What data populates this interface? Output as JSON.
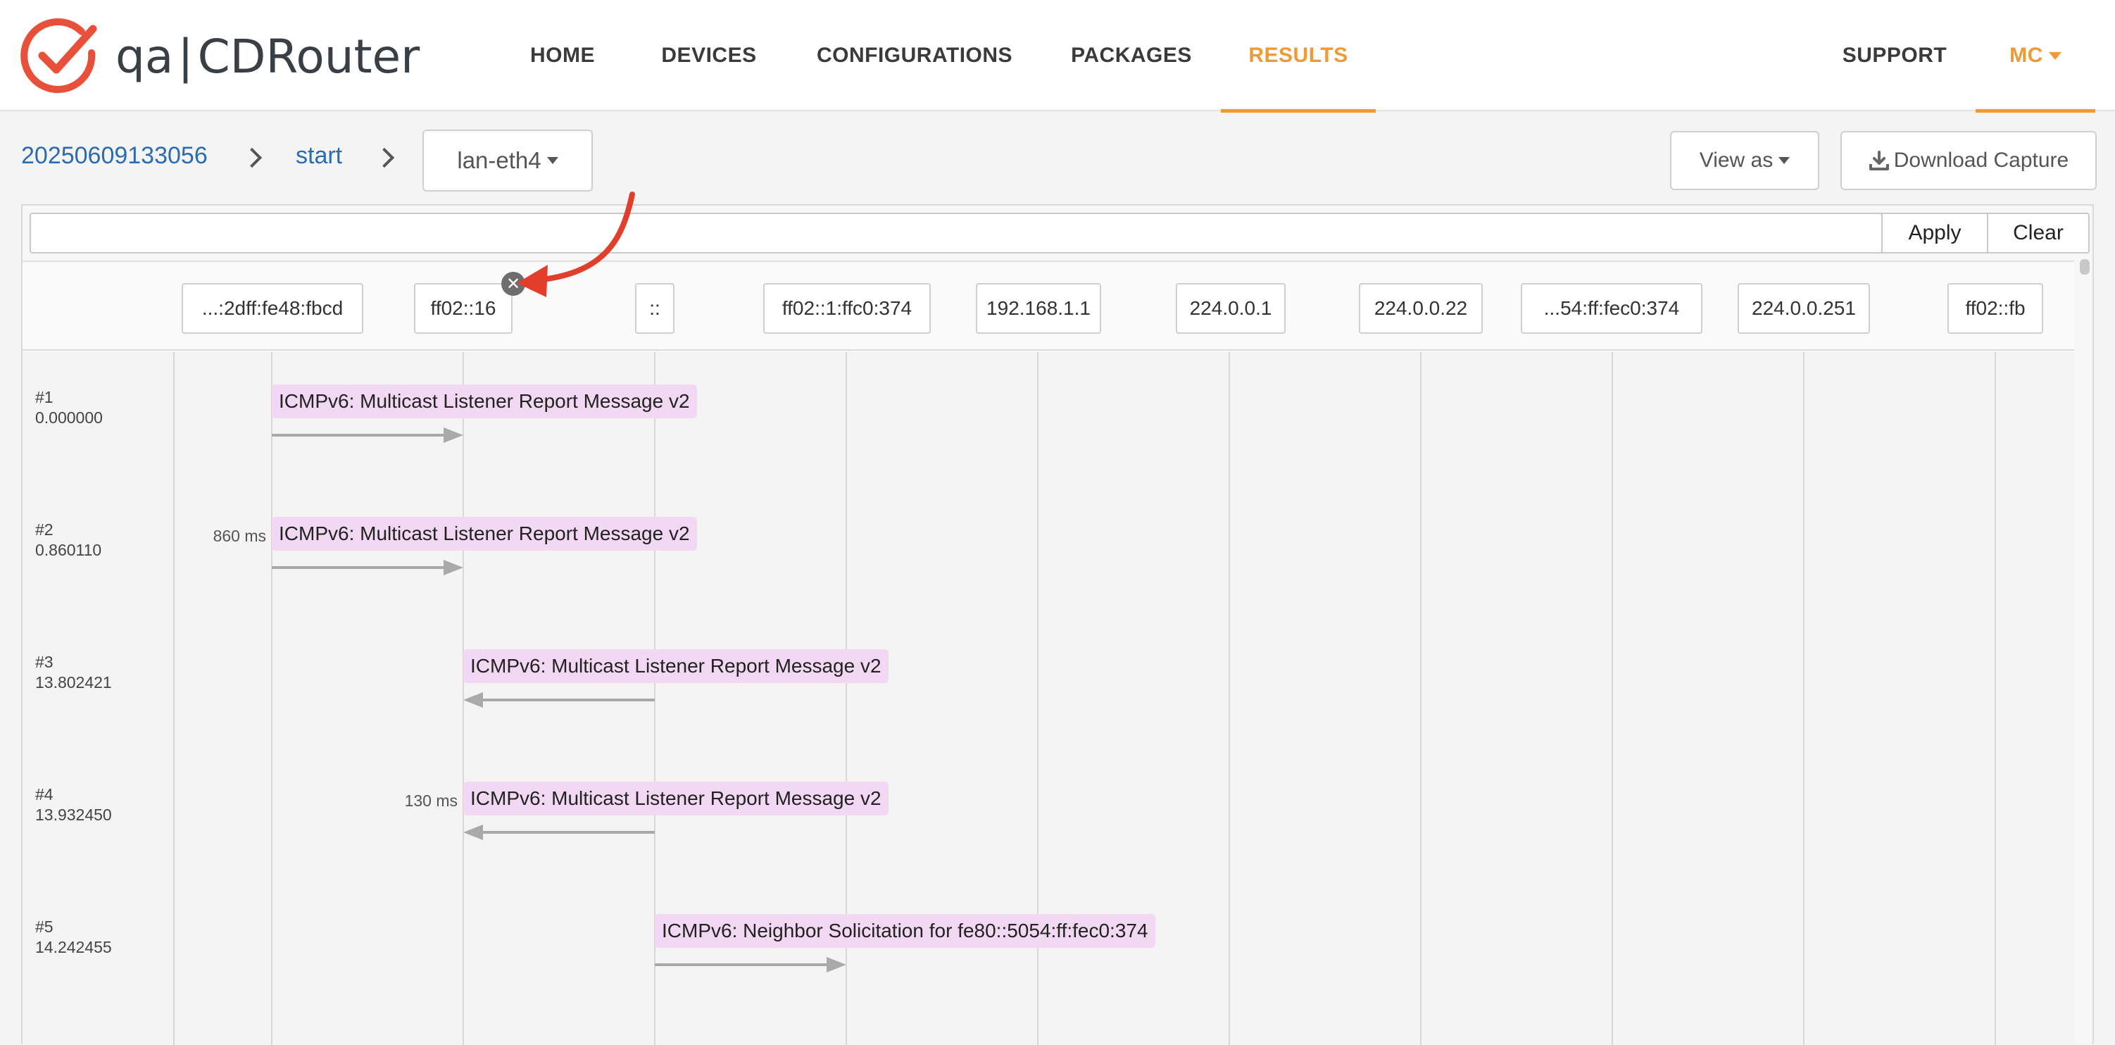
{
  "app": {
    "logo_prefix": "qa",
    "logo_name": "CDRouter",
    "brand_color": "#e8503a",
    "accent_color": "#ef9a34"
  },
  "nav": {
    "items": [
      "HOME",
      "DEVICES",
      "CONFIGURATIONS",
      "PACKAGES",
      "RESULTS"
    ],
    "active": "RESULTS",
    "support": "SUPPORT",
    "user": "MC"
  },
  "breadcrumb": {
    "result_id": "20250609133056",
    "test": "start",
    "interface": "lan-eth4"
  },
  "actions": {
    "view_as": "View as",
    "download": "Download Capture"
  },
  "filter": {
    "value": "",
    "placeholder": "",
    "apply": "Apply",
    "clear": "Clear"
  },
  "hosts": [
    "...:2dff:fe48:fbcd",
    "ff02::16",
    "::",
    "ff02::1:ffc0:374",
    "192.168.1.1",
    "224.0.0.1",
    "224.0.0.22",
    "...54:ff:fec0:374",
    "224.0.0.251",
    "ff02::fb"
  ],
  "packets": [
    {
      "num": "#1",
      "time": "0.000000",
      "delta": "",
      "info": "ICMPv6: Multicast Listener Report Message v2",
      "from": 0,
      "to": 1
    },
    {
      "num": "#2",
      "time": "0.860110",
      "delta": "860 ms",
      "info": "ICMPv6: Multicast Listener Report Message v2",
      "from": 0,
      "to": 1
    },
    {
      "num": "#3",
      "time": "13.802421",
      "delta": "",
      "info": "ICMPv6: Multicast Listener Report Message v2",
      "from": 2,
      "to": 1
    },
    {
      "num": "#4",
      "time": "13.932450",
      "delta": "130 ms",
      "info": "ICMPv6: Multicast Listener Report Message v2",
      "from": 2,
      "to": 1
    },
    {
      "num": "#5",
      "time": "14.242455",
      "delta": "",
      "info": "ICMPv6: Neighbor Solicitation for fe80::5054:ff:fec0:374",
      "from": 2,
      "to": 3
    }
  ]
}
